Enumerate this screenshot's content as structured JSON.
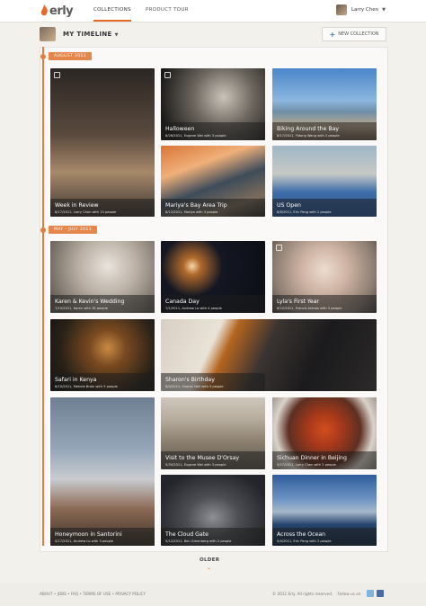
{
  "app": {
    "logo_text": "erly",
    "accent": "#e66b2a"
  },
  "nav": {
    "tabs": [
      "COLLECTIONS",
      "PRODUCT TOUR"
    ],
    "active_tab": "COLLECTIONS"
  },
  "user": {
    "name": "Larry Chen",
    "menu_icon": "chevron-down-icon"
  },
  "timeline": {
    "title": "MY TIMELINE",
    "new_collection_label": "NEW COLLECTION"
  },
  "sections": [
    {
      "date": "AUGUST 2011",
      "tiles": [
        {
          "title": "Week in Review",
          "sub": "8/17/2011, Larry Chen with 13 people"
        },
        {
          "title": "Halloween",
          "sub": "8/26/2011, Eugene Wei with 3 people"
        },
        {
          "title": "Biking Around the Bay",
          "sub": "8/17/2011, Yidong Wang with 2 people"
        },
        {
          "title": "Mariya's Bay Area Trip",
          "sub": "8/12/2011, Mariya with 3 people"
        },
        {
          "title": "US Open",
          "sub": "8/6/2011, Eric Pang with 2 people"
        }
      ]
    },
    {
      "date": "MAY - JULY 2011",
      "tiles": [
        {
          "title": "Karen & Kevin's Wedding",
          "sub": "7/10/2011, Karen with 18 people"
        },
        {
          "title": "Canada Day",
          "sub": "7/1/2011, Andrew Lo with 4 people"
        },
        {
          "title": "Lyla's First Year",
          "sub": "6/22/2011, Francis Arenas with 3 people"
        },
        {
          "title": "Safari in Kenya",
          "sub": "6/10/2011, Mehele Brain with 5 people"
        },
        {
          "title": "Sharon's Birthday",
          "sub": "6/4/2011, Sharon Neil with 9 people"
        },
        {
          "title": "Visit to the Musee D'Orsay",
          "sub": "5/30/2011, Eugene Wei with 3 people"
        },
        {
          "title": "Sichuan Dinner in Beijing",
          "sub": "5/27/2011, Larry Chen with 2 people"
        },
        {
          "title": "Honeymoon in Santorini",
          "sub": "5/17/2011, Andrew Lo with 3 people"
        },
        {
          "title": "The Cloud Gate",
          "sub": "5/12/2011, Ben Greenberg with 2 people"
        },
        {
          "title": "Across the Ocean",
          "sub": "5/4/2011, Eric Pang with 2 people"
        }
      ]
    }
  ],
  "older_label": "OLDER",
  "footer": {
    "links": [
      "ABOUT",
      "JOBS",
      "FAQ",
      "TERMS OF USE",
      "PRIVACY POLICY"
    ],
    "copyright": "© 2011 Erly. All rights reserved.",
    "follow_label": "Follow us on",
    "social_icons": [
      "twitter-icon",
      "facebook-icon"
    ]
  }
}
